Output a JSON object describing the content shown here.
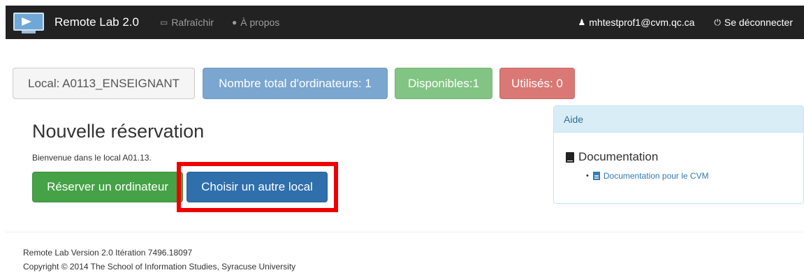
{
  "navbar": {
    "brand": "Remote Lab 2.0",
    "refresh_label": "Rafraîchir",
    "about_label": "À propos",
    "user_label": "mhtestprof1@cvm.qc.ca",
    "logout_label": "Se déconnecter"
  },
  "stats": {
    "local_label": "Local: A0113_ENSEIGNANT",
    "total_label": "Nombre total d'ordinateurs: 1",
    "available_label": "Disponibles:1",
    "used_label": "Utilisés: 0"
  },
  "main": {
    "title": "Nouvelle réservation",
    "welcome": "Bienvenue dans le local A01.13.",
    "reserve_button": "Réserver un ordinateur",
    "choose_button": "Choisir un autre local"
  },
  "help_panel": {
    "heading": "Aide",
    "doc_title": "Documentation",
    "doc_links": [
      "Documentation pour le CVM"
    ]
  },
  "footer": {
    "version": "Remote Lab Version 2.0 Itération 7496.18097",
    "copyright": "Copyright © 2014 The School of Information Studies, Syracuse University"
  },
  "colors": {
    "navbar_bg": "#222222",
    "primary": "#2f6fac",
    "success": "#45a246",
    "danger": "#d97874",
    "info": "#7aa6cf",
    "highlight": "#ee0000"
  },
  "icons": [
    "monitor-logo-icon",
    "desktop-icon",
    "info-circle-icon",
    "user-icon",
    "power-icon",
    "book-icon",
    "file-text-icon"
  ]
}
